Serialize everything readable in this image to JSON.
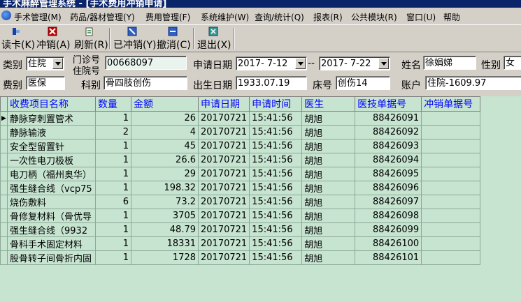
{
  "window": {
    "title": "手术麻醉管理系统 - [手术费用冲销申请]"
  },
  "menu": [
    "手术管理(M)",
    "药品/器材管理(Y)",
    "费用管理(F)",
    "系统维护(W)",
    "查询/统计(Q)",
    "报表(R)",
    "公共模块(R)",
    "窗口(U)",
    "帮助"
  ],
  "toolbar": {
    "card": "读卡(K)",
    "offset": "冲销(A)",
    "refresh": "刷新(R)",
    "already": "已冲销(Y)",
    "undo": "撤消(C)",
    "exit": "退出(X)"
  },
  "form": {
    "category_label": "类别",
    "category_value": "住院",
    "clinic_label_1": "门诊号",
    "clinic_label_2": "住院号",
    "clinic_value": "00668097",
    "apply_date_label": "申请日期",
    "date_from": "2017- 7-12",
    "date_sep": "--",
    "date_to": "2017- 7-22",
    "name_label": "姓名",
    "name_value": "徐娟娣",
    "gender_label": "性别",
    "gender_value": "女",
    "fee_label": "费别",
    "fee_value": "医保",
    "dept_label": "科别",
    "dept_value": "骨四肢创伤",
    "birth_label": "出生日期",
    "birth_value": "1933.07.19",
    "bed_label": "床号",
    "bed_value": "创伤14",
    "account_label": "账户",
    "account_value": "住院-1609.97"
  },
  "table": {
    "columns": [
      "收费项目名称",
      "数量",
      "金额",
      "申请日期",
      "申请时间",
      "医生",
      "医技单据号",
      "冲销单据号"
    ],
    "rows": [
      [
        "静脉穿刺置管术",
        "1",
        "26",
        "20170721",
        "15:41:56",
        "胡旭",
        "88426091",
        ""
      ],
      [
        "静脉输液",
        "2",
        "4",
        "20170721",
        "15:41:56",
        "胡旭",
        "88426092",
        ""
      ],
      [
        "安全型留置针",
        "1",
        "45",
        "20170721",
        "15:41:56",
        "胡旭",
        "88426093",
        ""
      ],
      [
        "一次性电刀极板",
        "1",
        "26.6",
        "20170721",
        "15:41:56",
        "胡旭",
        "88426094",
        ""
      ],
      [
        "电刀柄（福州奥华）",
        "1",
        "29",
        "20170721",
        "15:41:56",
        "胡旭",
        "88426095",
        ""
      ],
      [
        "强生缝合线（vcp75",
        "1",
        "198.32",
        "20170721",
        "15:41:56",
        "胡旭",
        "88426096",
        ""
      ],
      [
        "烧伤敷料",
        "6",
        "73.2",
        "20170721",
        "15:41:56",
        "胡旭",
        "88426097",
        ""
      ],
      [
        "骨修复材料（骨优导",
        "1",
        "3705",
        "20170721",
        "15:41:56",
        "胡旭",
        "88426098",
        ""
      ],
      [
        "强生缝合线（9932",
        "1",
        "48.79",
        "20170721",
        "15:41:56",
        "胡旭",
        "88426099",
        ""
      ],
      [
        "骨科手术固定材料",
        "1",
        "18331",
        "20170721",
        "15:41:56",
        "胡旭",
        "88426100",
        ""
      ],
      [
        "股骨转子间骨折内固",
        "1",
        "1728",
        "20170721",
        "15:41:56",
        "胡旭",
        "88426101",
        ""
      ]
    ],
    "current_indicator": "▶"
  }
}
